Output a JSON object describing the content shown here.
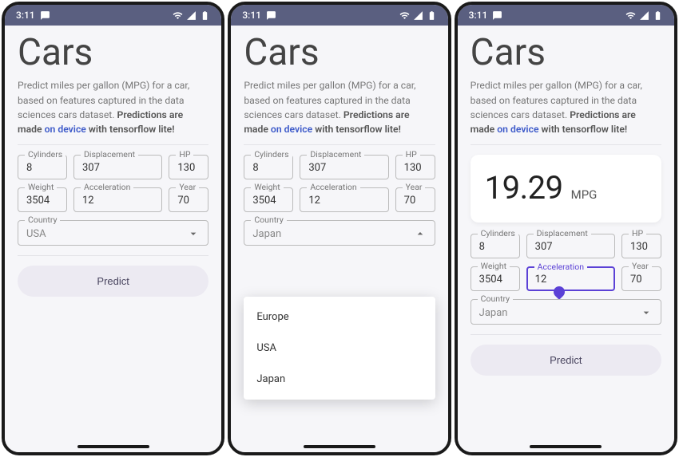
{
  "status": {
    "time": "3:11"
  },
  "app": {
    "title": "Cars",
    "subtitle_a": "Predict miles per gallon (MPG) for a car, based on features captured in the data sciences cars dataset. ",
    "subtitle_b": "Predictions are made ",
    "subtitle_link": "on device",
    "subtitle_c": " with tensorflow lite!"
  },
  "labels": {
    "cylinders": "Cylinders",
    "displacement": "Displacement",
    "hp": "HP",
    "weight": "Weight",
    "acceleration": "Acceleration",
    "year": "Year",
    "country": "Country",
    "predict": "Predict"
  },
  "values": {
    "cylinders": "8",
    "displacement": "307",
    "hp": "130",
    "weight": "3504",
    "acceleration": "12",
    "year": "70"
  },
  "screen1": {
    "country": "USA"
  },
  "screen2": {
    "country": "Japan",
    "options": [
      "Europe",
      "USA",
      "Japan"
    ]
  },
  "screen3": {
    "result_value": "19.29",
    "result_unit": "MPG",
    "country": "Japan"
  }
}
